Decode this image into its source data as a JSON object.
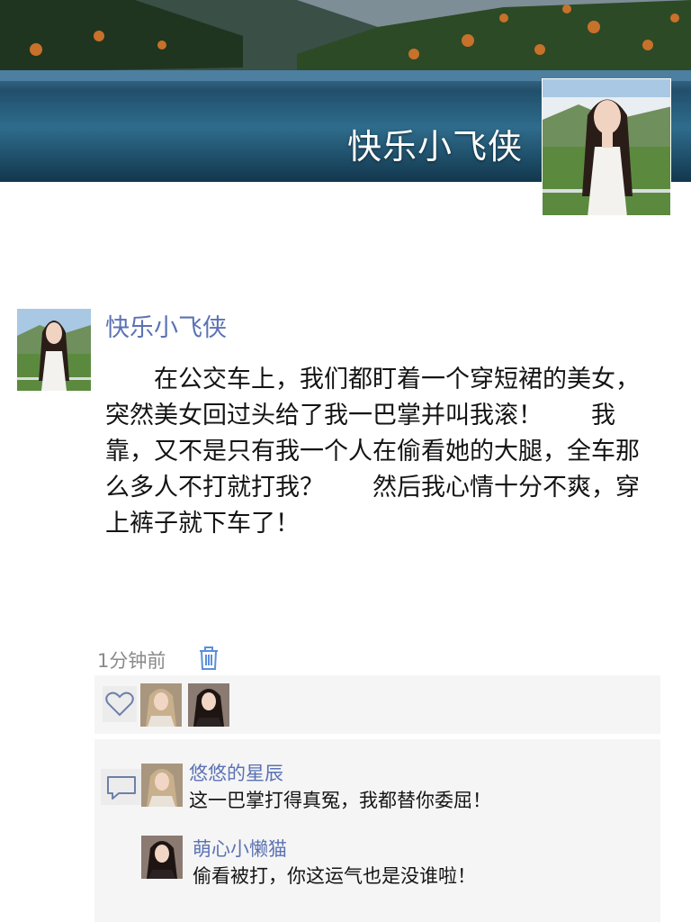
{
  "cover": {
    "name": "快乐小飞侠",
    "avatar_icon": "profile-photo-woman-long-hair"
  },
  "post": {
    "author": "快乐小飞侠",
    "content": "　　在公交车上，我们都盯着一个穿短裙的美女，　　突然美女回过头给了我一巴掌并叫我滚！　　我靠，又不是只有我一个人在偷看她的大腿，全车那么多人不打就打我？　　然后我心情十分不爽，穿上裤子就下车了！",
    "time": "1分钟前",
    "delete_icon": "trash-icon"
  },
  "likes": {
    "icon": "heart-icon",
    "users": [
      "liker-1",
      "liker-2"
    ]
  },
  "comments": [
    {
      "name": "悠悠的星辰",
      "text": "这一巴掌打得真冤，我都替你委屈！"
    },
    {
      "name": "萌心小懒猫",
      "text": "偷看被打，你这运气也是没谁啦！"
    }
  ],
  "colors": {
    "name_blue": "#5b72b4",
    "panel_bg": "#f5f5f5",
    "time_gray": "#8a8a8a"
  }
}
